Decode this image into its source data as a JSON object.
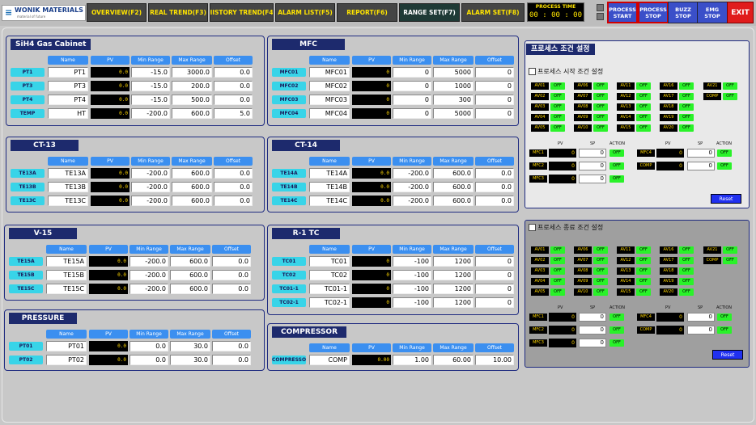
{
  "app": {
    "logo_text": "WONIK MATERIALS",
    "logo_sub": "material of future"
  },
  "nav": [
    {
      "label": "OVERVIEW(F2)"
    },
    {
      "label": "REAL TREND(F3)"
    },
    {
      "label": "HISTORY TREND(F4)"
    },
    {
      "label": "ALARM LIST(F5)"
    },
    {
      "label": "REPORT(F6)"
    },
    {
      "label": "RANGE SET(F7)"
    },
    {
      "label": "ALARM SET(F8)"
    }
  ],
  "process_time": {
    "label": "PROCESS TIME",
    "value": "00 : 00 : 00"
  },
  "controls": {
    "process_start": "PROCESS START",
    "process_stop": "PROCESS STOP",
    "buzz_stop": "BUZZ STOP",
    "emg_stop": "EMG STOP",
    "exit": "EXIT"
  },
  "headers": {
    "name": "Name",
    "pv": "PV",
    "min": "Min Range",
    "max": "Max Range",
    "offset": "Offset"
  },
  "panels": {
    "sih4": {
      "title": "SiH4 Gas Cabinet",
      "rows": [
        {
          "tag": "PT1",
          "name": "PT1",
          "pv": "0.0",
          "min": "-15.0",
          "max": "3000.0",
          "offset": "0.0"
        },
        {
          "tag": "PT3",
          "name": "PT3",
          "pv": "0.0",
          "min": "-15.0",
          "max": "200.0",
          "offset": "0.0"
        },
        {
          "tag": "PT4",
          "name": "PT4",
          "pv": "0.0",
          "min": "-15.0",
          "max": "500.0",
          "offset": "0.0"
        },
        {
          "tag": "TEMP",
          "name": "HT",
          "pv": "0.0",
          "min": "-200.0",
          "max": "600.0",
          "offset": "5.0"
        }
      ]
    },
    "mfc": {
      "title": "MFC",
      "rows": [
        {
          "tag": "MFC01",
          "name": "MFC01",
          "pv": "0",
          "min": "0",
          "max": "5000",
          "offset": "0"
        },
        {
          "tag": "MFC02",
          "name": "MFC02",
          "pv": "0",
          "min": "0",
          "max": "1000",
          "offset": "0"
        },
        {
          "tag": "MFC03",
          "name": "MFC03",
          "pv": "0",
          "min": "0",
          "max": "300",
          "offset": "0"
        },
        {
          "tag": "MFC04",
          "name": "MFC04",
          "pv": "0",
          "min": "0",
          "max": "5000",
          "offset": "0"
        }
      ]
    },
    "ct13": {
      "title": "CT-13",
      "rows": [
        {
          "tag": "TE13A",
          "name": "TE13A",
          "pv": "0.0",
          "min": "-200.0",
          "max": "600.0",
          "offset": "0.0"
        },
        {
          "tag": "TE13B",
          "name": "TE13B",
          "pv": "0.0",
          "min": "-200.0",
          "max": "600.0",
          "offset": "0.0"
        },
        {
          "tag": "TE13C",
          "name": "TE13C",
          "pv": "0.0",
          "min": "-200.0",
          "max": "600.0",
          "offset": "0.0"
        }
      ]
    },
    "ct14": {
      "title": "CT-14",
      "rows": [
        {
          "tag": "TE14A",
          "name": "TE14A",
          "pv": "0.0",
          "min": "-200.0",
          "max": "600.0",
          "offset": "0.0"
        },
        {
          "tag": "TE14B",
          "name": "TE14B",
          "pv": "0.0",
          "min": "-200.0",
          "max": "600.0",
          "offset": "0.0"
        },
        {
          "tag": "TE14C",
          "name": "TE14C",
          "pv": "0.0",
          "min": "-200.0",
          "max": "600.0",
          "offset": "0.0"
        }
      ]
    },
    "v15": {
      "title": "V-15",
      "rows": [
        {
          "tag": "TE15A",
          "name": "TE15A",
          "pv": "0.0",
          "min": "-200.0",
          "max": "600.0",
          "offset": "0.0"
        },
        {
          "tag": "TE15B",
          "name": "TE15B",
          "pv": "0.0",
          "min": "-200.0",
          "max": "600.0",
          "offset": "0.0"
        },
        {
          "tag": "TE15C",
          "name": "TE15C",
          "pv": "0.0",
          "min": "-200.0",
          "max": "600.0",
          "offset": "0.0"
        }
      ]
    },
    "r1tc": {
      "title": "R-1 TC",
      "rows": [
        {
          "tag": "TC01",
          "name": "TC01",
          "pv": "0",
          "min": "-100",
          "max": "1200",
          "offset": "0"
        },
        {
          "tag": "TC02",
          "name": "TC02",
          "pv": "0",
          "min": "-100",
          "max": "1200",
          "offset": "0"
        },
        {
          "tag": "TC01-1",
          "name": "TC01-1",
          "pv": "0",
          "min": "-100",
          "max": "1200",
          "offset": "0"
        },
        {
          "tag": "TC02-1",
          "name": "TC02-1",
          "pv": "0",
          "min": "-100",
          "max": "1200",
          "offset": "0"
        }
      ]
    },
    "pressure": {
      "title": "PRESSURE",
      "rows": [
        {
          "tag": "PT01",
          "name": "PT01",
          "pv": "0.0",
          "min": "0.0",
          "max": "30.0",
          "offset": "0.0"
        },
        {
          "tag": "PT02",
          "name": "PT02",
          "pv": "0.0",
          "min": "0.0",
          "max": "30.0",
          "offset": "0.0"
        }
      ]
    },
    "compressor": {
      "title": "COMPRESSOR",
      "rows": [
        {
          "tag": "COMPRESSOR",
          "name": "COMP",
          "pv": "0.00",
          "min": "1.00",
          "max": "60.00",
          "offset": "10.00"
        }
      ]
    }
  },
  "start_cond": {
    "title": "프로세스 시작 조건 설정",
    "panel_title": "프로세스 조건 설정",
    "valves": [
      [
        "AV01",
        "OFF",
        "AV06",
        "OFF",
        "AV11",
        "OFF",
        "AV16",
        "OFF",
        "AV21",
        "OFF"
      ],
      [
        "AV02",
        "OFF",
        "AV07",
        "OFF",
        "AV12",
        "OFF",
        "AV17",
        "OFF",
        "COMP",
        "OFF"
      ],
      [
        "AV03",
        "OFF",
        "AV08",
        "OFF",
        "AV13",
        "OFF",
        "AV18",
        "OFF"
      ],
      [
        "AV04",
        "OFF",
        "AV09",
        "OFF",
        "AV14",
        "OFF",
        "AV19",
        "OFF"
      ],
      [
        "AV05",
        "OFF",
        "AV10",
        "OFF",
        "AV15",
        "OFF",
        "AV20",
        "OFF"
      ]
    ],
    "col_pv": "PV",
    "col_sp": "SP",
    "col_action": "ACTION",
    "mfc_left": [
      {
        "name": "MFC1",
        "pv": "0",
        "sp": "0",
        "action": "OFF"
      },
      {
        "name": "MFC2",
        "pv": "0",
        "sp": "0",
        "action": "OFF"
      },
      {
        "name": "MFC3",
        "pv": "0",
        "sp": "0",
        "action": "OFF"
      }
    ],
    "mfc_right": [
      {
        "name": "MFC4",
        "pv": "0",
        "sp": "0",
        "action": "OFF"
      },
      {
        "name": "COMP",
        "pv": "0",
        "sp": "0",
        "action": "OFF"
      }
    ],
    "reset": "Reset"
  },
  "end_cond": {
    "title": "프로세스 종료 조건 설정",
    "reset": "Reset"
  }
}
